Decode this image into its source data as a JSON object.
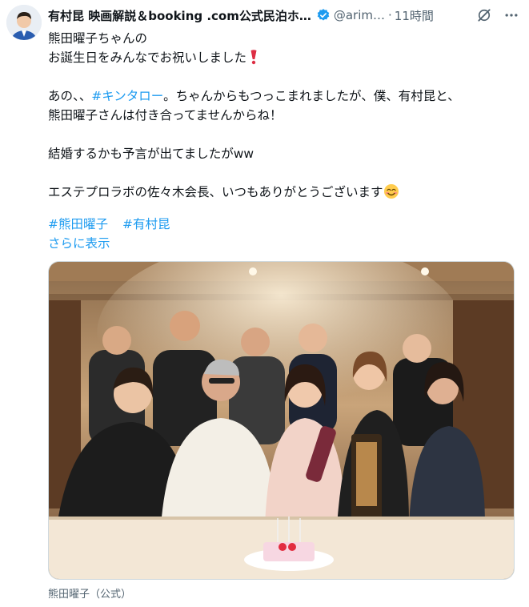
{
  "author": {
    "display_name": "有村昆 映画解説＆booking .com公式民泊ホ…",
    "handle": "@arim…",
    "separator": "·",
    "time": "11時間"
  },
  "post": {
    "line1": "熊田曜子ちゃんの",
    "line2": "お誕生日をみんなでお祝いしました",
    "line3_pre": "あの、、",
    "line3_link": "#キンタロー",
    "line3_post": "。ちゃんからもつっこまれましたが、僕、有村昆と、",
    "line4": "熊田曜子さんは付き合ってませんからね！",
    "line5": "結婚するかも予言が出てましたがww",
    "line6": "エステプロラボの佐々木会長、いつもありがとうございます",
    "hashtags": [
      "#熊田曜子",
      "#有村昆"
    ],
    "show_more": "さらに表示"
  },
  "media": {
    "tagged": "熊田曜子（公式）"
  },
  "icons": {
    "verified": "verified-badge-icon",
    "grok": "grok-icon",
    "more": "more-options-icon",
    "heart_emoji": "red-exclamation-emoji",
    "smile_emoji": "smiling-face-emoji"
  },
  "colors": {
    "link": "#1d9bf0",
    "secondary_text": "#536471",
    "text": "#0f1419"
  }
}
